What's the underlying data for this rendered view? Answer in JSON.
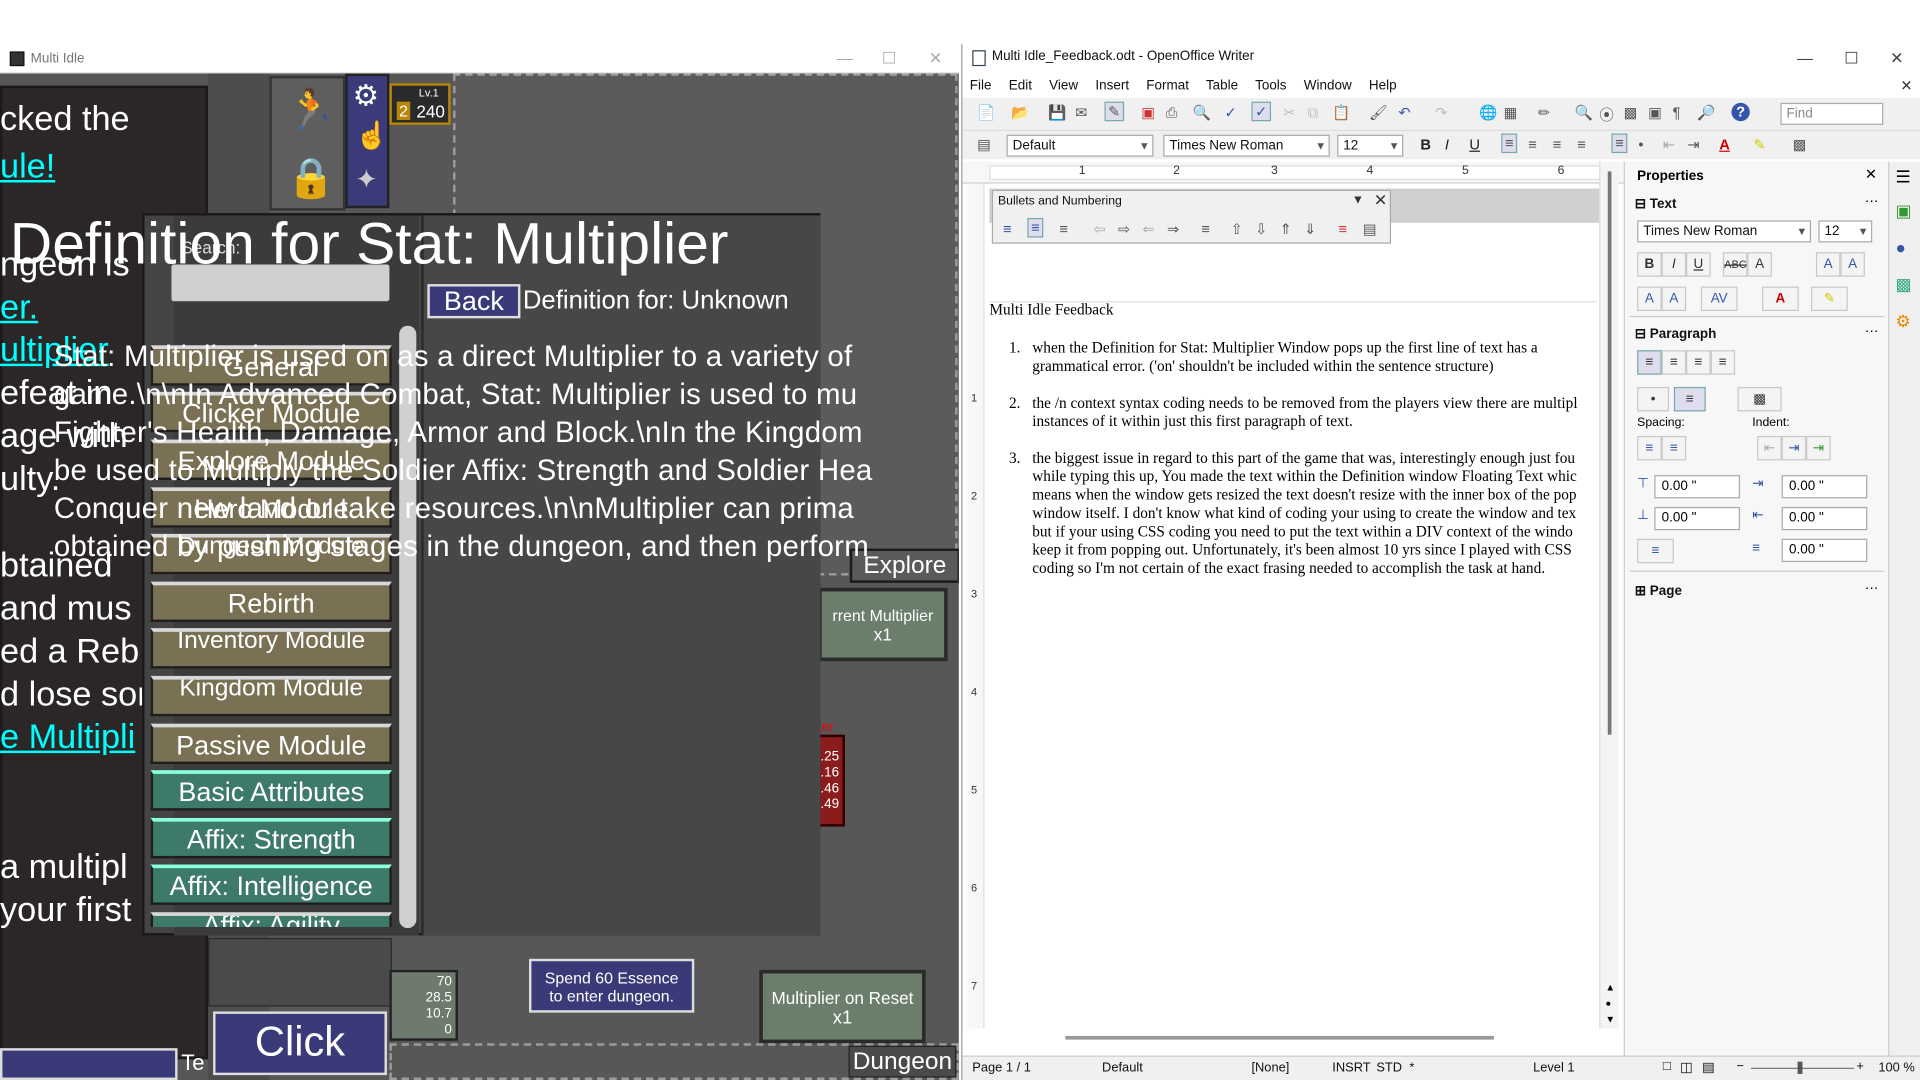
{
  "game_window": {
    "title": "Multi Idle",
    "icon": "app-icon",
    "level_label": "Lv.1",
    "level_value": "240",
    "level_num": "2"
  },
  "game": {
    "left_lines": [
      "cked the",
      "ule!",
      "ngeon is",
      "er.",
      "ultiplier",
      "efeat in",
      "age with",
      "ulty.",
      "btained",
      "and mus",
      "ed a Reb",
      "d lose sor",
      "e Multipli",
      "a multipl",
      "your first"
    ],
    "definition_title": "Definition for Stat: Multiplier",
    "search_label": "Search:",
    "back_button": "Back",
    "definition_for": "Definition for: Unknown",
    "floating_lines": [
      "Stat: Multiplier is used on as a direct Multiplier to a variety of",
      "game.\\n\\nIn Advanced Combat, Stat: Multiplier is used to mu",
      "Fighter's Health, Damage, Armor and Block.\\nIn the Kingdom",
      "be used to Multiply the Soldier Affix: Strength and Soldier Hea",
      "Conquer new land or take resources.\\n\\nMultiplier can prima",
      "obtained by pushing stages in the dungeon, and then perform"
    ],
    "modules": [
      "General",
      "Clicker Module",
      "Explore Module",
      "Hero Module",
      "Dungeon Module",
      "Rebirth",
      "Inventory Module",
      "Kingdom Module",
      "Passive Module",
      "Basic Attributes",
      "Affix: Strength",
      "Affix: Intelligence",
      "Affix: Agility"
    ],
    "explore_label": "Explore",
    "current_multiplier_label": "rrent Multiplier",
    "current_multiplier_value": "x1",
    "stat_header": "ter",
    "stat_values": [
      ".25",
      ".16",
      ".46",
      ".49"
    ],
    "small_stats": [
      "70",
      "28.5",
      "10.7",
      "0"
    ],
    "spend_essence": "Spend 60 Essence to enter dungeon.",
    "multiplier_on_reset_label": "Multiplier on Reset",
    "multiplier_on_reset_value": "x1",
    "click_button": "Click",
    "dungeon_label": "Dungeon",
    "bottom_left_label": "Te"
  },
  "writer": {
    "title": "Multi Idle_Feedback.odt - OpenOffice Writer",
    "menu": [
      "File",
      "Edit",
      "View",
      "Insert",
      "Format",
      "Table",
      "Tools",
      "Window",
      "Help"
    ],
    "find_placeholder": "Find",
    "paragraph_style": "Default",
    "font_name": "Times New Roman",
    "font_size": "12",
    "bullets_panel_title": "Bullets and Numbering",
    "doc_heading": "Multi Idle Feedback",
    "items": [
      {
        "num": "1.",
        "lines": [
          "when the Definition for Stat: Multiplier Window pops up the first line of text has a",
          "grammatical error. ('on' shouldn't be included within the sentence structure)"
        ]
      },
      {
        "num": "2.",
        "lines": [
          "the /n context syntax coding needs to be removed from the players view there are multipl",
          "instances of it within just this first paragraph of text."
        ]
      },
      {
        "num": "3.",
        "lines": [
          "the biggest issue in regard to this part of the game that was, interestingly enough just fou",
          "while typing this up, You made the text within the Definition window Floating Text whic",
          "means when the window gets resized the text doesn't resize with the inner box of the pop",
          "window itself. I don't know what kind of coding your using to create the window and tex",
          "but if your using CSS coding you need to put the text within a DIV context of the windo",
          "keep it from popping out. Unfortunately, it's been almost 10 yrs since I played with CSS",
          "coding so I'm not certain of the exact frasing needed to accomplish the task at hand."
        ]
      }
    ],
    "ruler_numbers": [
      "1",
      "2",
      "3",
      "4",
      "5",
      "6"
    ],
    "vruler_numbers": [
      "1",
      "2",
      "3",
      "4",
      "5",
      "6",
      "7"
    ],
    "properties": {
      "title": "Properties",
      "text_section": "Text",
      "font_name": "Times New Roman",
      "font_size": "12",
      "paragraph_section": "Paragraph",
      "spacing_label": "Spacing:",
      "indent_label": "Indent:",
      "spin_values": [
        "0.00 \"",
        "0.00 \"",
        "0.00 \"",
        "0.00 \"",
        "0.00 \""
      ],
      "page_section": "Page"
    },
    "status": {
      "page": "Page 1 / 1",
      "style": "Default",
      "lang": "[None]",
      "insert": "INSRT",
      "sel": "STD",
      "level": "Level 1",
      "zoom": "100 %"
    }
  }
}
